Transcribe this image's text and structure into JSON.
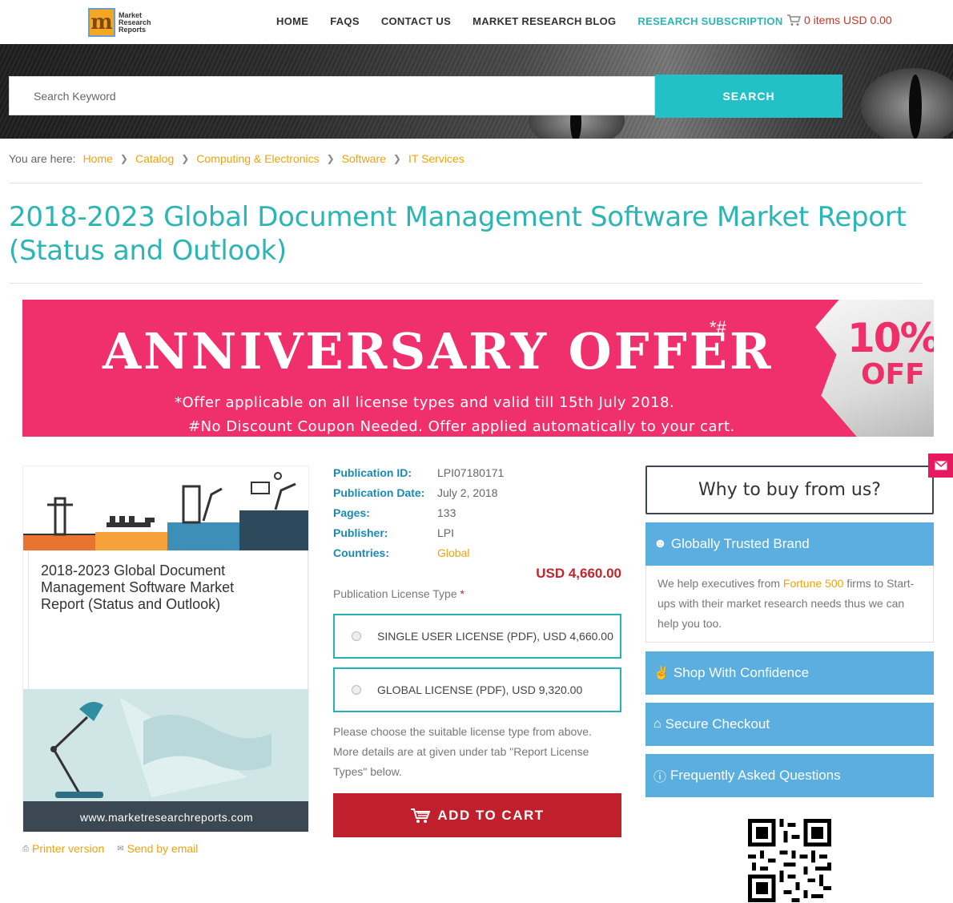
{
  "header": {
    "logo_text": [
      "Market",
      "Research",
      "Reports"
    ],
    "logo_letter": "m",
    "nav": [
      "HOME",
      "FAQS",
      "CONTACT US",
      "MARKET RESEARCH BLOG",
      "RESEARCH SUBSCRIPTION"
    ],
    "cart": "0 items USD 0.00"
  },
  "search": {
    "placeholder": "Search Keyword",
    "button": "SEARCH"
  },
  "breadcrumb": {
    "prefix": "You are here:",
    "items": [
      "Home",
      "Catalog",
      "Computing & Electronics",
      "Software",
      "IT Services"
    ]
  },
  "page_title": "2018-2023 Global Document Management Software Market Report (Status and Outlook)",
  "banner": {
    "headline": "ANNIVERSARY OFFER",
    "mark": "*#",
    "line1": "*Offer applicable on all license types and valid till 15th July 2018.",
    "line2": "#No Discount Coupon Needed. Offer applied automatically to your cart.",
    "discount_pct": "10%",
    "discount_off": "OFF"
  },
  "product_image": {
    "caption": "2018-2023 Global Document Management Software Market Report (Status and Outlook)",
    "url": "www.marketresearchreports.com"
  },
  "tools": {
    "printer": "Printer version",
    "email": "Send by email"
  },
  "meta": [
    {
      "key": "Publication ID:",
      "value": "LPI07180171"
    },
    {
      "key": "Publication Date:",
      "value": "July 2, 2018"
    },
    {
      "key": "Pages:",
      "value": "133"
    },
    {
      "key": "Publisher:",
      "value": "LPI"
    },
    {
      "key": "Countries:",
      "value": "Global"
    }
  ],
  "price": "USD 4,660.00",
  "license": {
    "label": "Publication License Type",
    "required": "*",
    "options": [
      "SINGLE USER LICENSE (PDF), USD 4,660.00",
      "GLOBAL LICENSE (PDF), USD 9,320.00"
    ],
    "note": "Please choose the suitable license type from above. More details are at given under tab \"Report License Types\" below.",
    "add_to_cart": "ADD TO CART"
  },
  "why": {
    "title": "Why to buy from us?",
    "sections": [
      "Globally Trusted Brand",
      "Shop With Confidence",
      "Secure Checkout",
      "Frequently Asked Questions"
    ],
    "body_pre": "We help executives from ",
    "body_hl": "Fortune 500",
    "body_post": " firms to Start-ups with their market research needs thus we can help you too."
  },
  "colors": {
    "teal": "#23c0c8",
    "orange": "#f0a30a",
    "red": "#c0202b",
    "banner_pink": "#f0306c",
    "accordion_blue": "#5aaee0"
  }
}
